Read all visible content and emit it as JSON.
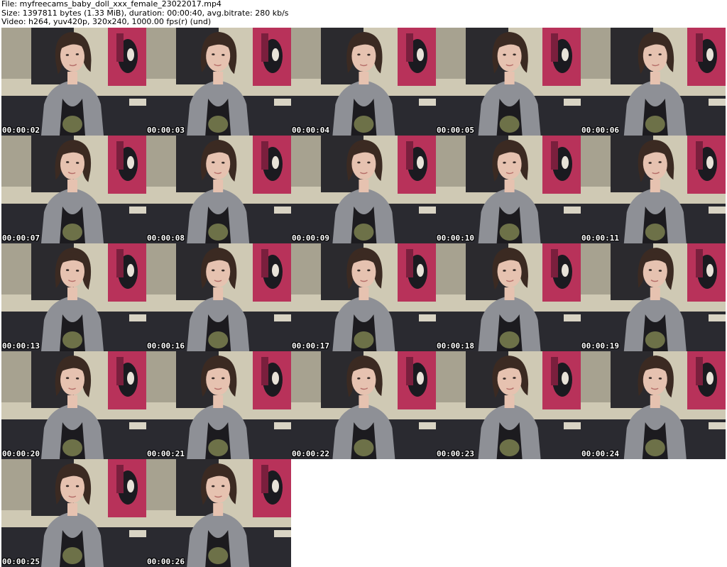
{
  "header": {
    "file_line": "File: myfreecams_baby_doll_xxx_female_23022017.mp4",
    "size_line": "Size: 1397811 bytes (1.33 MiB), duration: 00:00:40, avg.bitrate: 280 kb/s",
    "video_line": "Video: h264, yuv420p, 320x240, 1000.00 fps(r) (und)"
  },
  "frames": [
    {
      "timestamp": "00:00:02"
    },
    {
      "timestamp": "00:00:03"
    },
    {
      "timestamp": "00:00:04"
    },
    {
      "timestamp": "00:00:05"
    },
    {
      "timestamp": "00:00:06"
    },
    {
      "timestamp": "00:00:07"
    },
    {
      "timestamp": "00:00:08"
    },
    {
      "timestamp": "00:00:09"
    },
    {
      "timestamp": "00:00:10"
    },
    {
      "timestamp": "00:00:11"
    },
    {
      "timestamp": "00:00:13"
    },
    {
      "timestamp": "00:00:16"
    },
    {
      "timestamp": "00:00:17"
    },
    {
      "timestamp": "00:00:18"
    },
    {
      "timestamp": "00:00:19"
    },
    {
      "timestamp": "00:00:20"
    },
    {
      "timestamp": "00:00:21"
    },
    {
      "timestamp": "00:00:22"
    },
    {
      "timestamp": "00:00:23"
    },
    {
      "timestamp": "00:00:24"
    },
    {
      "timestamp": "00:00:25"
    },
    {
      "timestamp": "00:00:26"
    }
  ],
  "colors": {
    "wall": "#cfc9b4",
    "poster_dark": "#2b2a2e",
    "poster_red": "#b8325a",
    "hair": "#3b2a22",
    "skin": "#e6c2b0",
    "cardigan": "#8e9096",
    "top": "#1c1b1f",
    "shirt_print": "#7b8050",
    "couch": "#2a2a30"
  }
}
